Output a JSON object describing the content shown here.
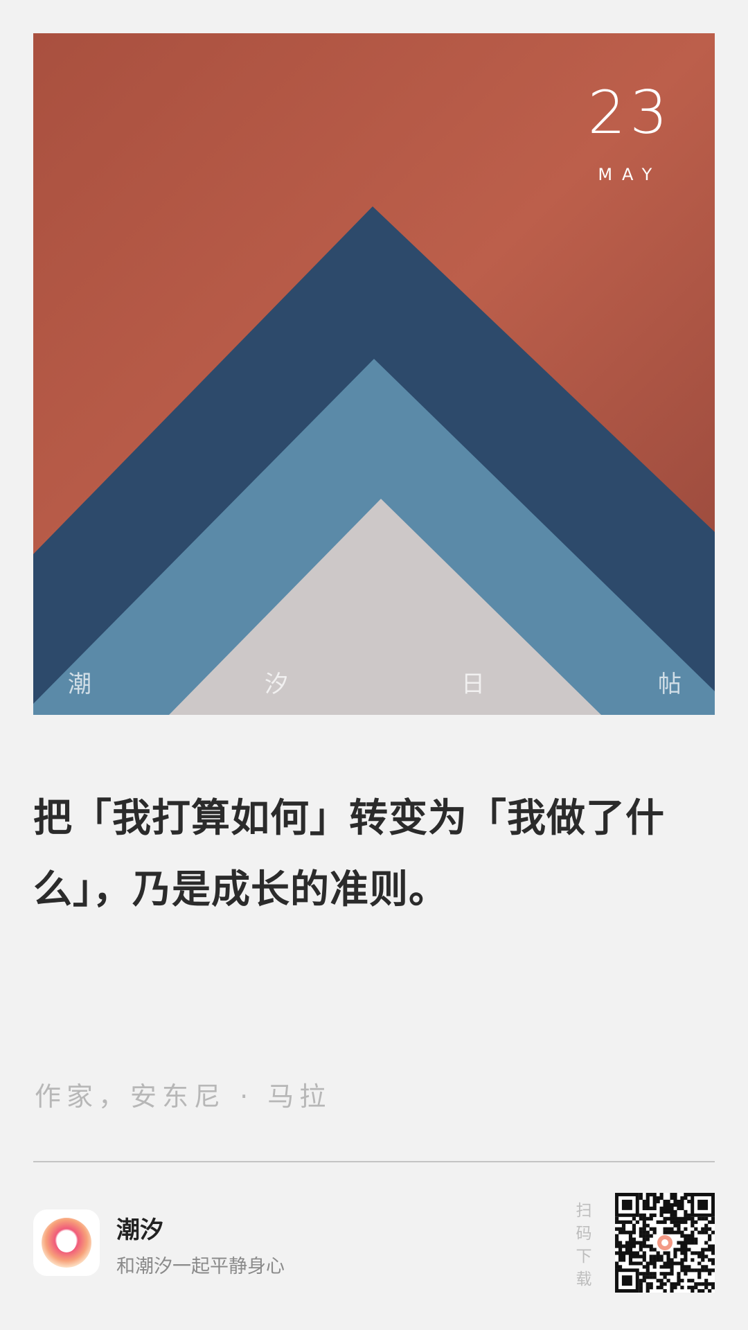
{
  "hero": {
    "date_day": "23",
    "date_month": "MAY",
    "brand_chars": [
      "潮",
      "汐",
      "日",
      "帖"
    ],
    "colors": {
      "background": "#b65a48",
      "dark_blue": "#2d4a6b",
      "mid_blue": "#5b8aa8",
      "grey": "#cdc8c8"
    }
  },
  "quote": {
    "text": "把「我打算如何」转变为「我做了什么」，乃是成长的准则。"
  },
  "author": {
    "text": "作家，安东尼 · 马拉"
  },
  "footer": {
    "app_name": "潮汐",
    "slogan": "和潮汐一起平静身心",
    "scan_chars": [
      "扫",
      "码",
      "下",
      "载"
    ],
    "app_icon": "tide-logo-icon",
    "qr_icon": "qr-code-icon"
  }
}
